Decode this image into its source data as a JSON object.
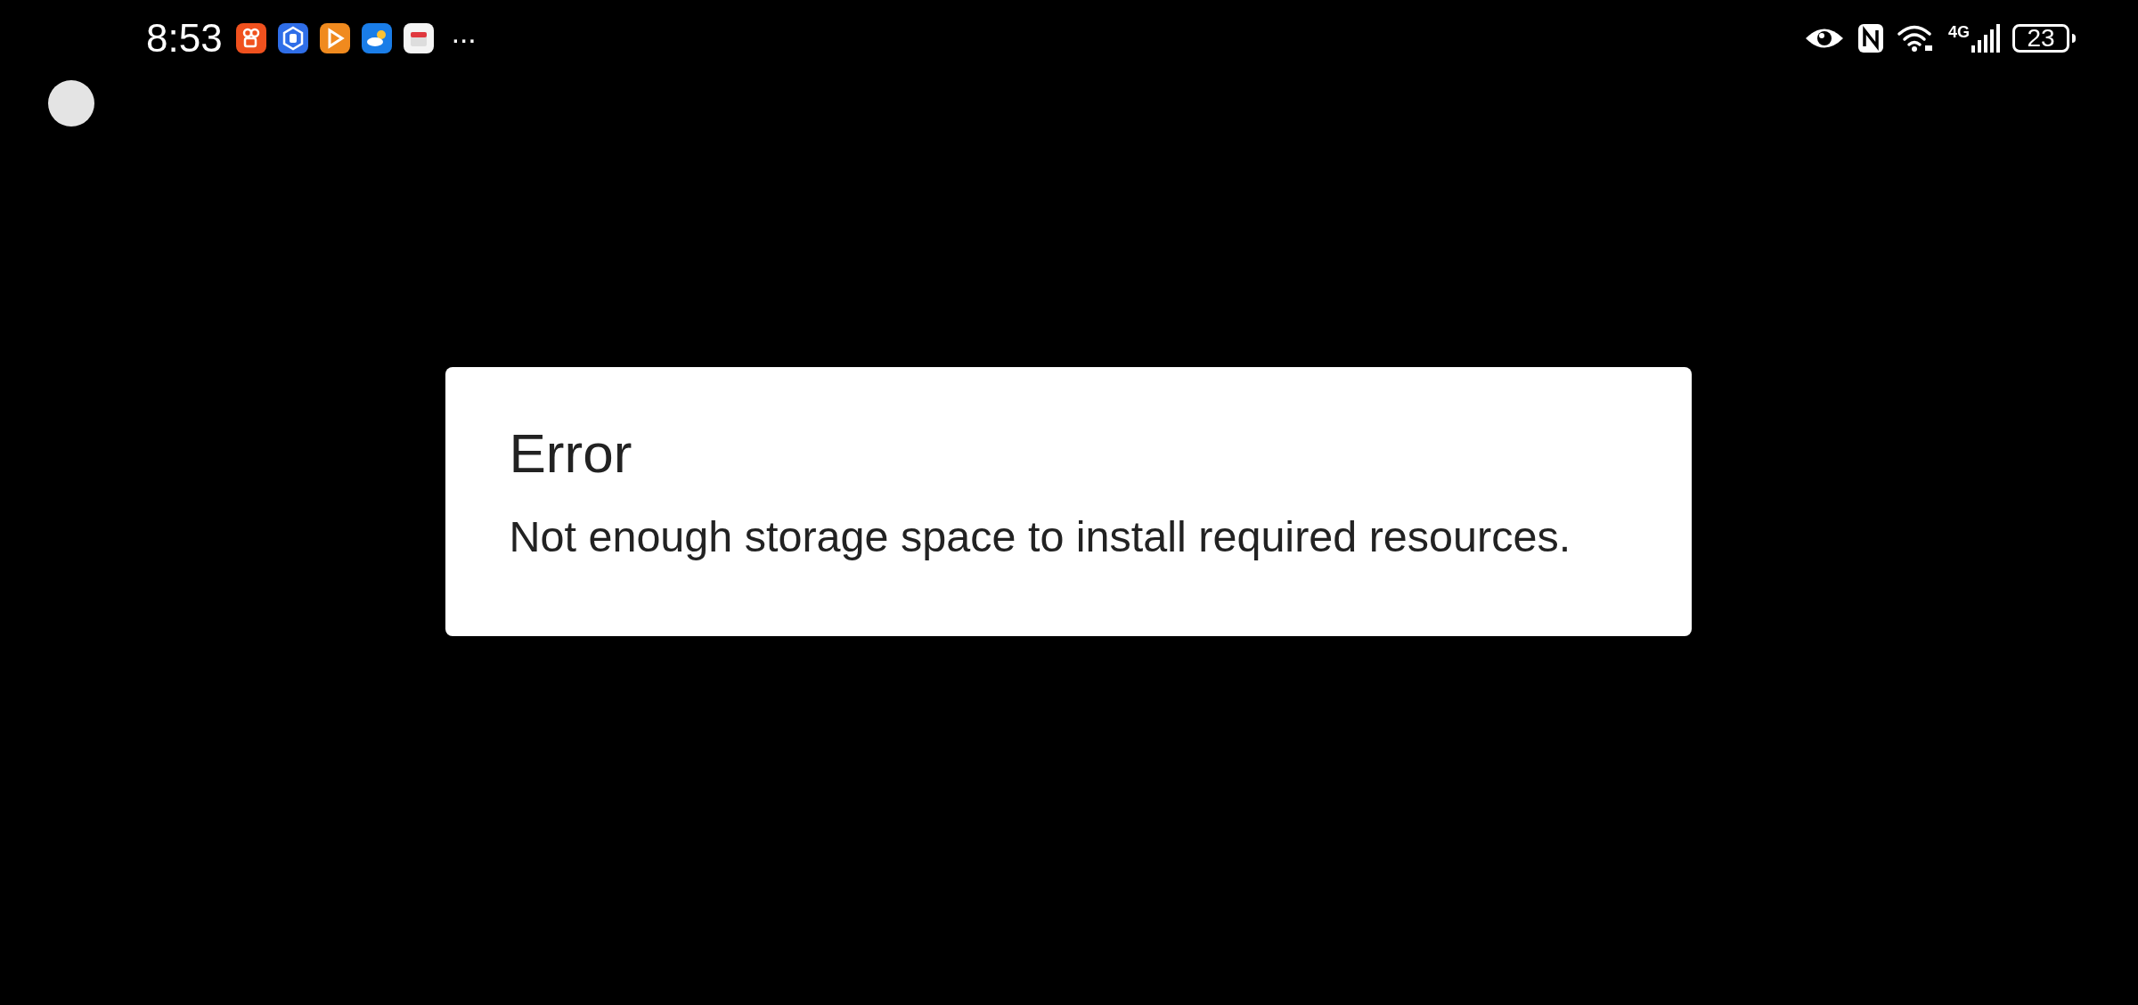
{
  "status_bar": {
    "time": "8:53",
    "more": "···",
    "network": "4G",
    "battery": "23"
  },
  "dialog": {
    "title": "Error",
    "message": "Not enough storage space to install required resources."
  }
}
